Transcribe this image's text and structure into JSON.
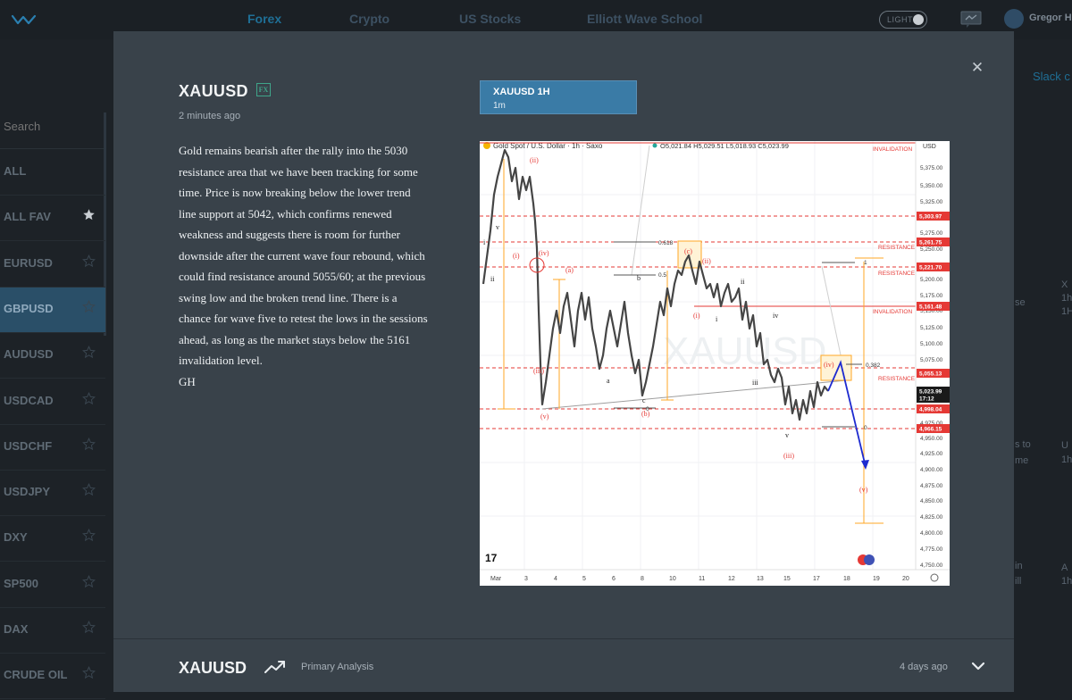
{
  "nav": {
    "links": [
      "Forex",
      "Crypto",
      "US Stocks",
      "Elliott Wave School"
    ],
    "theme_toggle": "LIGHT",
    "user": "Gregor H",
    "slack_link": "Slack c"
  },
  "sidebar": {
    "search_placeholder": "Search",
    "items": [
      {
        "label": "ALL"
      },
      {
        "label": "ALL FAV",
        "star": "filled"
      },
      {
        "label": "EURUSD"
      },
      {
        "label": "GBPUSD",
        "selected": true
      },
      {
        "label": "AUDUSD"
      },
      {
        "label": "USDCAD"
      },
      {
        "label": "USDCHF"
      },
      {
        "label": "USDJPY"
      },
      {
        "label": "DXY"
      },
      {
        "label": "SP500"
      },
      {
        "label": "DAX"
      },
      {
        "label": "CRUDE OIL"
      }
    ]
  },
  "background_feed": {
    "fragments": [
      "X",
      "1h",
      "se",
      "1H",
      "s to",
      "me",
      "U",
      "1h",
      "in",
      "ill",
      "A",
      "1h"
    ]
  },
  "modal": {
    "title": "XAUUSD",
    "badge": "FX",
    "time": "2 minutes ago",
    "body": [
      "Gold remains bearish after the rally into the 5030 resistance area that we have been tracking for some time. Price is now breaking below the lower trend line support at 5042, which confirms renewed weakness and suggests there is room for further downside after the current wave four rebound, which could find resistance around 5055/60; at the previous swing low and the broken trend line. There is a chance for wave five to retest the lows in the sessions ahead, as long as the market stays below the 5161 invalidation level.",
      "GH"
    ],
    "chart_tab": {
      "title": "XAUUSD 1H",
      "subtitle": "1m"
    },
    "footer": {
      "title": "XAUUSD",
      "label": "Primary Analysis",
      "time": "4 days ago"
    }
  },
  "chart_image": {
    "header": "Gold Spot / U.S. Dollar · 1h · Saxo",
    "ohlc": "O5,021.84 H5,029.51 L5,018.93 C5,023.99",
    "currency": "USD",
    "watermark": "XAUUSD",
    "y_ticks": [
      "5,375.00",
      "5,350.00",
      "5,325.00",
      "5,275.00",
      "5,250.00",
      "5,200.00",
      "5,175.00",
      "5,150.00",
      "5,125.00",
      "5,100.00",
      "5,075.00",
      "5,050.00",
      "4,975.00",
      "4,950.00",
      "4,925.00",
      "4,900.00",
      "4,875.00",
      "4,850.00",
      "4,825.00",
      "4,800.00",
      "4,775.00",
      "4,750.00"
    ],
    "x_ticks": [
      "Mar",
      "3",
      "4",
      "5",
      "6",
      "8",
      "10",
      "11",
      "12",
      "13",
      "15",
      "17",
      "18",
      "19",
      "20"
    ],
    "price_tags": [
      {
        "text": "5,303.97",
        "color": "#e53935"
      },
      {
        "text": "5,261.75",
        "color": "#e53935"
      },
      {
        "text": "5,221.70",
        "color": "#e53935"
      },
      {
        "text": "5,161.48",
        "color": "#e53935"
      },
      {
        "text": "5,055.13",
        "color": "#e53935"
      },
      {
        "text": "5,023.99",
        "color": "#1a1a1a"
      },
      {
        "text": "17:12",
        "color": "#1a1a1a"
      },
      {
        "text": "4,998.04",
        "color": "#e53935"
      },
      {
        "text": "4,966.15",
        "color": "#e53935"
      }
    ],
    "zone_labels": [
      "INVALIDATION",
      "RESISTANCE",
      "RESISTANCE",
      "INVALIDATION",
      "RESISTANCE"
    ],
    "fib_labels": [
      "0.618",
      "0.5",
      "0.382",
      "1",
      "0",
      "0"
    ],
    "wave_labels_red": [
      "(ii)",
      "(i)",
      "(iv)",
      "(a)",
      "(iii)",
      "(v)",
      "(c)",
      "(ii)",
      "(i)",
      "(b)",
      "(iv)",
      "(iii)",
      "(v)"
    ],
    "wave_labels_black": [
      "v",
      "i",
      "ii",
      "b",
      "a",
      "c",
      "ii",
      "i",
      "iv",
      "iii",
      "v"
    ],
    "brand_mark": "17"
  }
}
